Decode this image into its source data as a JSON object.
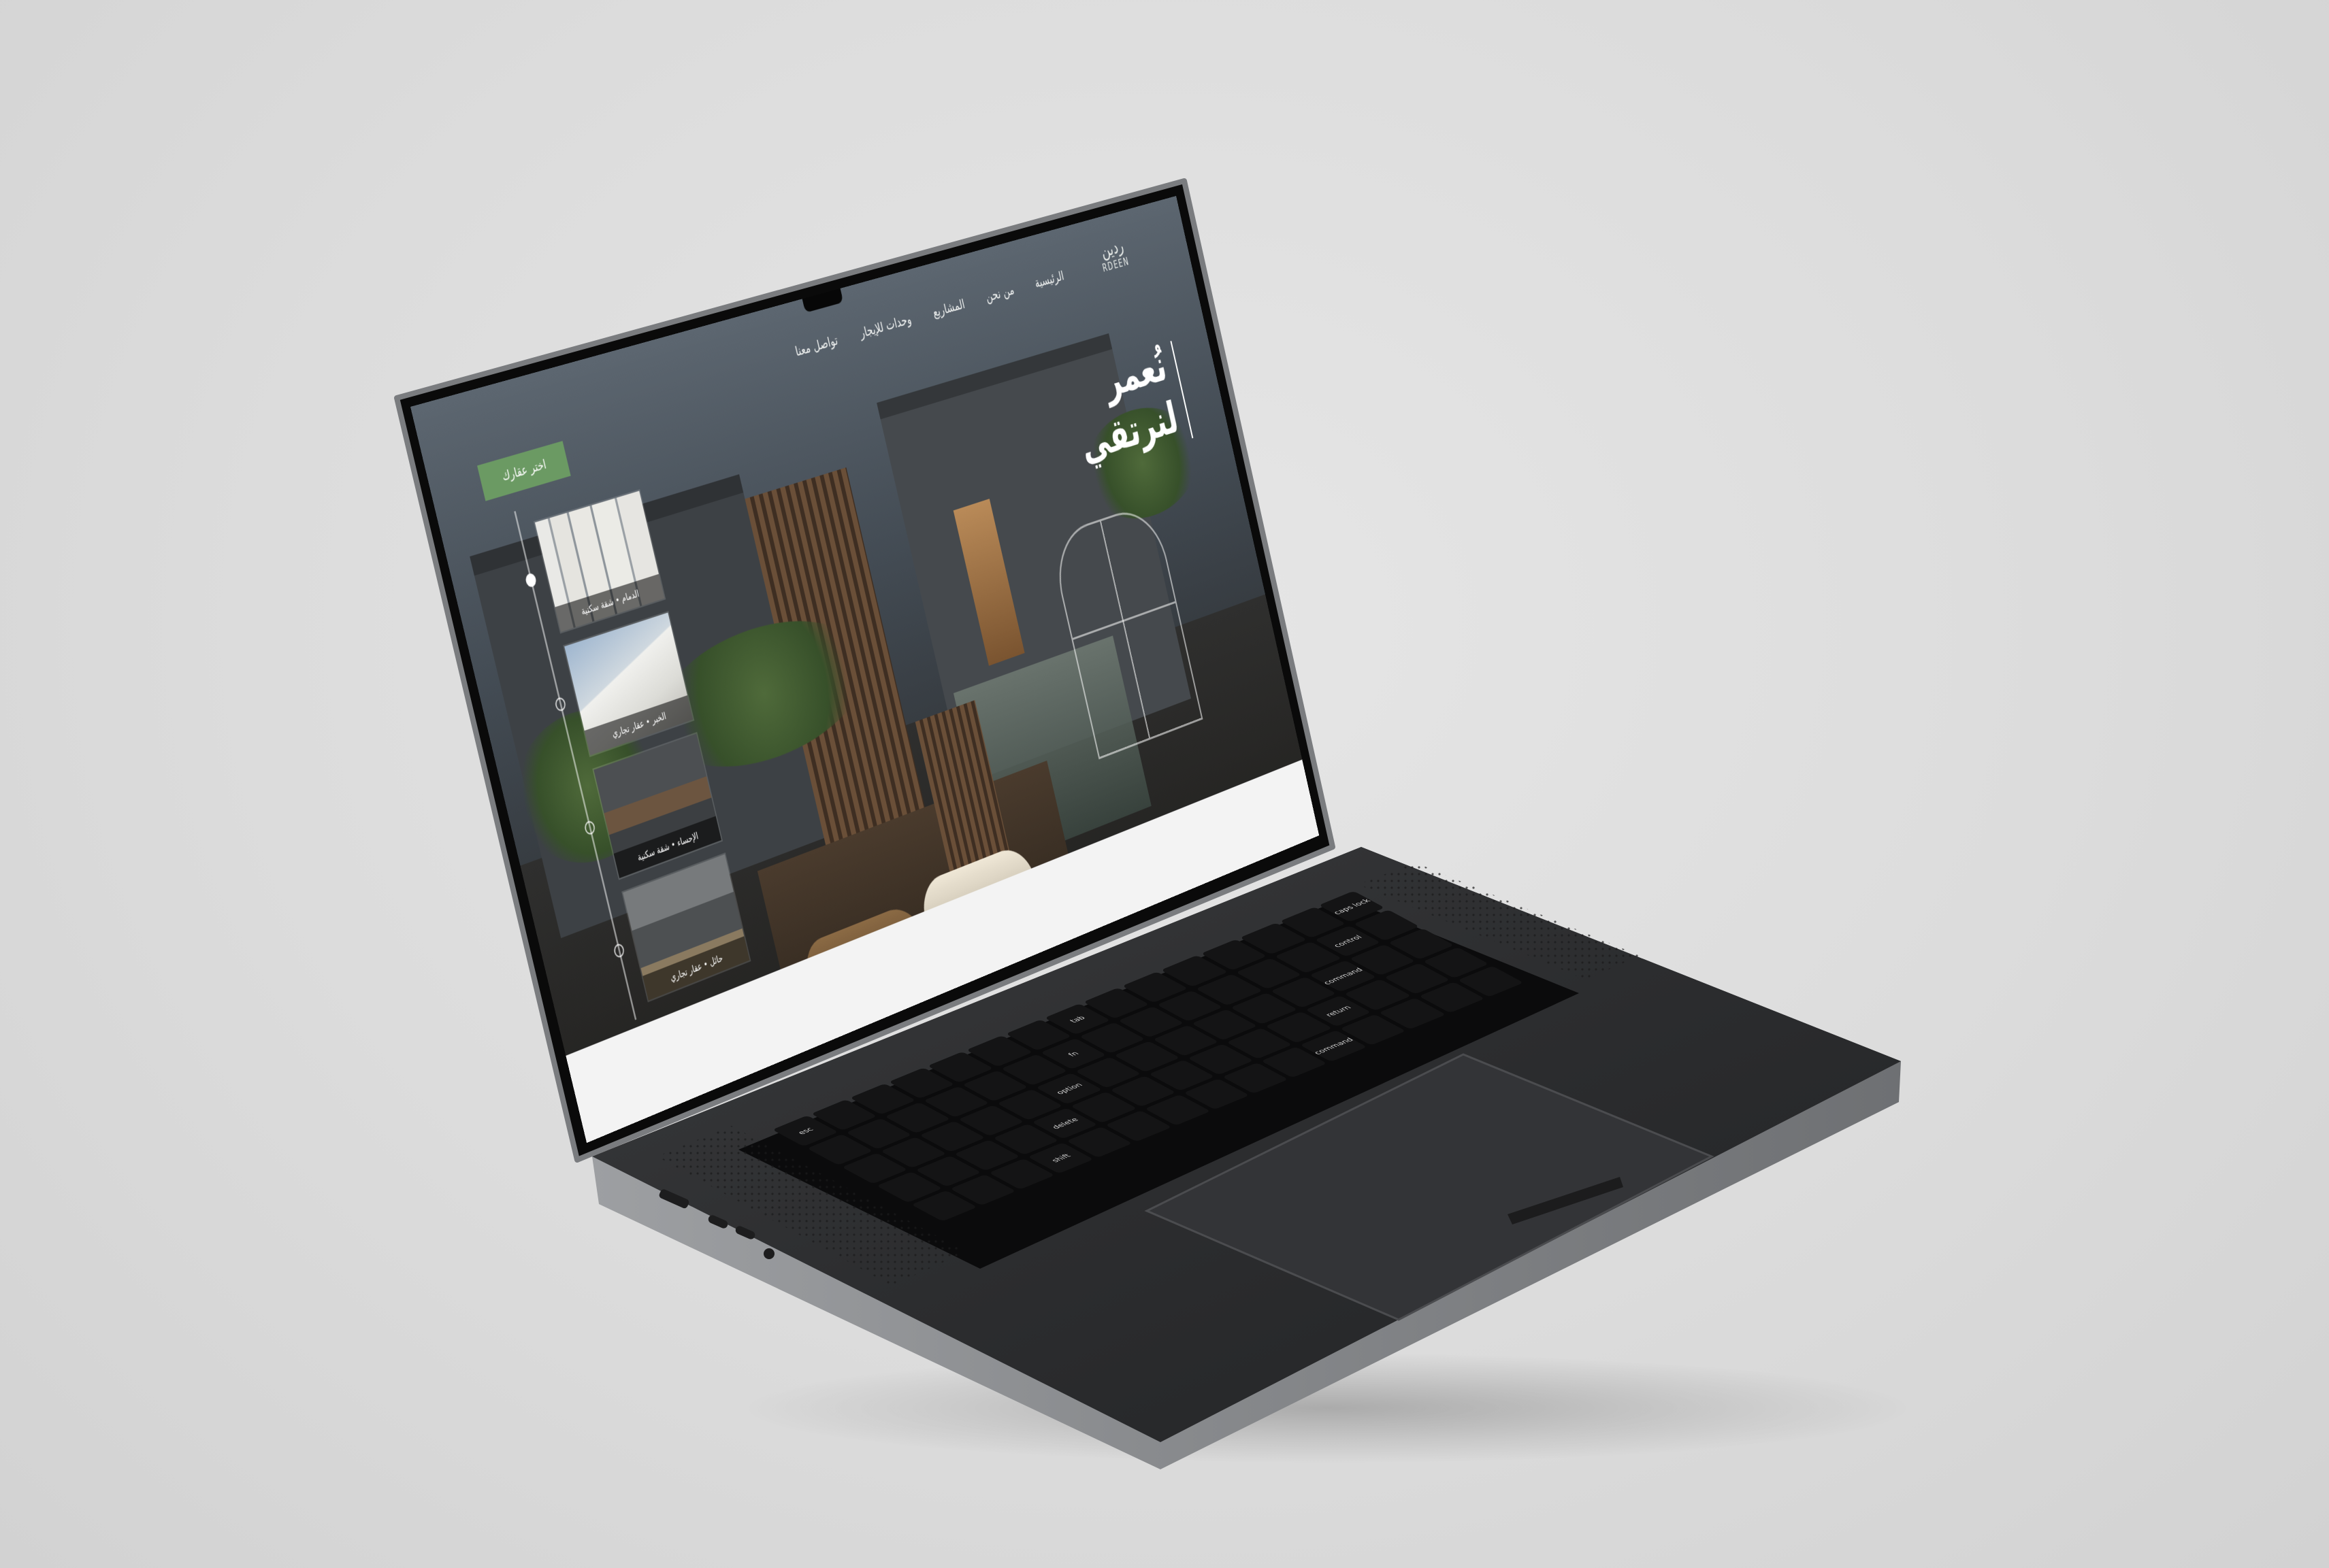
{
  "site": {
    "logo_ar": "ردين",
    "logo_en": "RDEEN",
    "nav": [
      {
        "label": "الرئيسية"
      },
      {
        "label": "من نحن"
      },
      {
        "label": "المشاريع"
      },
      {
        "label": "وحدات للإيجار"
      },
      {
        "label": "تواصل معنا"
      }
    ],
    "cta_label": "اختر عقارك",
    "tagline_line1": "نُعمر",
    "tagline_line2": "لنرتقي",
    "properties": [
      {
        "caption": "الدمام • شقة سكنية",
        "active": true
      },
      {
        "caption": "الخبر • عقار تجاري",
        "active": false
      },
      {
        "caption": "الإحساء • شقة سكنية",
        "active": false
      },
      {
        "caption": "حائل • عقار تجاري",
        "active": false
      }
    ]
  },
  "keyboard": {
    "keys": [
      "esc",
      "tab",
      "caps lock",
      "fn",
      "control",
      "option",
      "command",
      "delete",
      "return",
      "shift",
      "command",
      "option"
    ]
  },
  "colors": {
    "accent_green": "#6b9a63",
    "laptop_body": "#2b2c2e",
    "background": "#dcdcdc"
  }
}
